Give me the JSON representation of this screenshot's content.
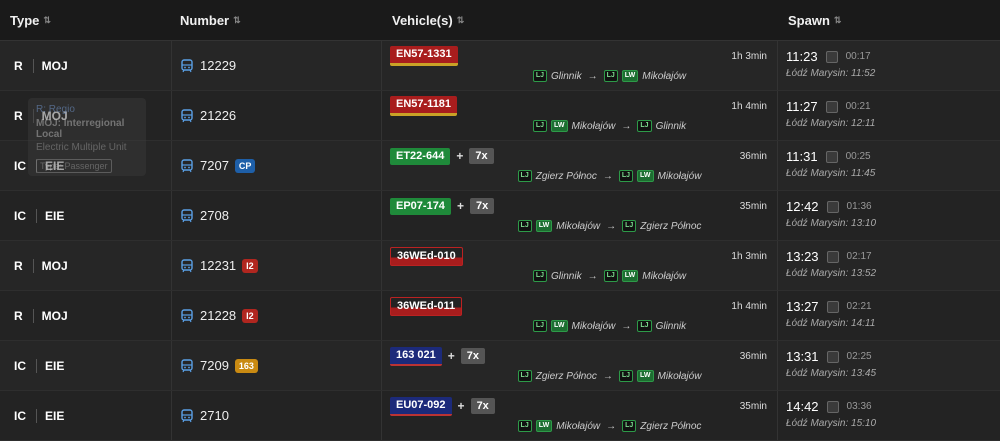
{
  "header": {
    "type": "Type",
    "number": "Number",
    "vehicles": "Vehicle(s)",
    "spawn": "Spawn"
  },
  "rows": [
    {
      "category": "R",
      "carrier": "MOJ",
      "number": "12229",
      "badge": "",
      "badge_color": "",
      "vehicle": "EN57-1331",
      "vehicle_style": "red",
      "cars": "",
      "duration": "1h 3min",
      "route_from": "Glinnik",
      "route_to": "Mikołajów",
      "from_tags": [
        "LJ"
      ],
      "to_tags": [
        "LJ",
        "LW"
      ],
      "time": "11:23",
      "delay": "00:17",
      "arrival": "Łódź Marysin: 11:52"
    },
    {
      "category": "R",
      "carrier": "MOJ",
      "number": "21226",
      "badge": "",
      "badge_color": "",
      "vehicle": "EN57-1181",
      "vehicle_style": "red",
      "cars": "",
      "duration": "1h 4min",
      "route_from": "Mikołajów",
      "route_to": "Glinnik",
      "from_tags": [
        "LJ",
        "LW"
      ],
      "to_tags": [
        "LJ"
      ],
      "time": "11:27",
      "delay": "00:21",
      "arrival": "Łódź Marysin: 12:11"
    },
    {
      "category": "IC",
      "carrier": "EIE",
      "number": "7207",
      "badge": "CP",
      "badge_color": "#1e5fa8",
      "vehicle": "ET22-644",
      "vehicle_style": "green",
      "cars": "7x",
      "duration": "36min",
      "route_from": "Zgierz Północ",
      "route_to": "Mikołajów",
      "from_tags": [
        "LJ"
      ],
      "to_tags": [
        "LJ",
        "LW"
      ],
      "time": "11:31",
      "delay": "00:25",
      "arrival": "Łódź Marysin: 11:45"
    },
    {
      "category": "IC",
      "carrier": "EIE",
      "number": "2708",
      "badge": "",
      "badge_color": "",
      "vehicle": "EP07-174",
      "vehicle_style": "green",
      "cars": "7x",
      "duration": "35min",
      "route_from": "Mikołajów",
      "route_to": "Zgierz Północ",
      "from_tags": [
        "LJ",
        "LW"
      ],
      "to_tags": [
        "LJ"
      ],
      "time": "12:42",
      "delay": "01:36",
      "arrival": "Łódź Marysin: 13:10"
    },
    {
      "category": "R",
      "carrier": "MOJ",
      "number": "12231",
      "badge": "I2",
      "badge_color": "#b0261f",
      "vehicle": "36WEd-010",
      "vehicle_style": "emu",
      "cars": "",
      "duration": "1h 3min",
      "route_from": "Glinnik",
      "route_to": "Mikołajów",
      "from_tags": [
        "LJ"
      ],
      "to_tags": [
        "LJ",
        "LW"
      ],
      "time": "13:23",
      "delay": "02:17",
      "arrival": "Łódź Marysin: 13:52"
    },
    {
      "category": "R",
      "carrier": "MOJ",
      "number": "21228",
      "badge": "I2",
      "badge_color": "#b0261f",
      "vehicle": "36WEd-011",
      "vehicle_style": "emu",
      "cars": "",
      "duration": "1h 4min",
      "route_from": "Mikołajów",
      "route_to": "Glinnik",
      "from_tags": [
        "LJ",
        "LW"
      ],
      "to_tags": [
        "LJ"
      ],
      "time": "13:27",
      "delay": "02:21",
      "arrival": "Łódź Marysin: 14:11"
    },
    {
      "category": "IC",
      "carrier": "EIE",
      "number": "7209",
      "badge": "163",
      "badge_color": "#c98a12",
      "vehicle": "163 021",
      "vehicle_style": "navy",
      "cars": "7x",
      "duration": "36min",
      "route_from": "Zgierz Północ",
      "route_to": "Mikołajów",
      "from_tags": [
        "LJ"
      ],
      "to_tags": [
        "LJ",
        "LW"
      ],
      "time": "13:31",
      "delay": "02:25",
      "arrival": "Łódź Marysin: 13:45"
    },
    {
      "category": "IC",
      "carrier": "EIE",
      "number": "2710",
      "badge": "",
      "badge_color": "",
      "vehicle": "EU07-092",
      "vehicle_style": "navy",
      "cars": "7x",
      "duration": "35min",
      "route_from": "Mikołajów",
      "route_to": "Zgierz Północ",
      "from_tags": [
        "LJ",
        "LW"
      ],
      "to_tags": [
        "LJ"
      ],
      "time": "14:42",
      "delay": "03:36",
      "arrival": "Łódź Marysin: 15:10"
    }
  ],
  "tooltip": {
    "title": "R: Regio",
    "line1": "MOJ: Interregional Local",
    "line2": "Electric Multiple Unit",
    "line3": "Type: Passenger"
  }
}
